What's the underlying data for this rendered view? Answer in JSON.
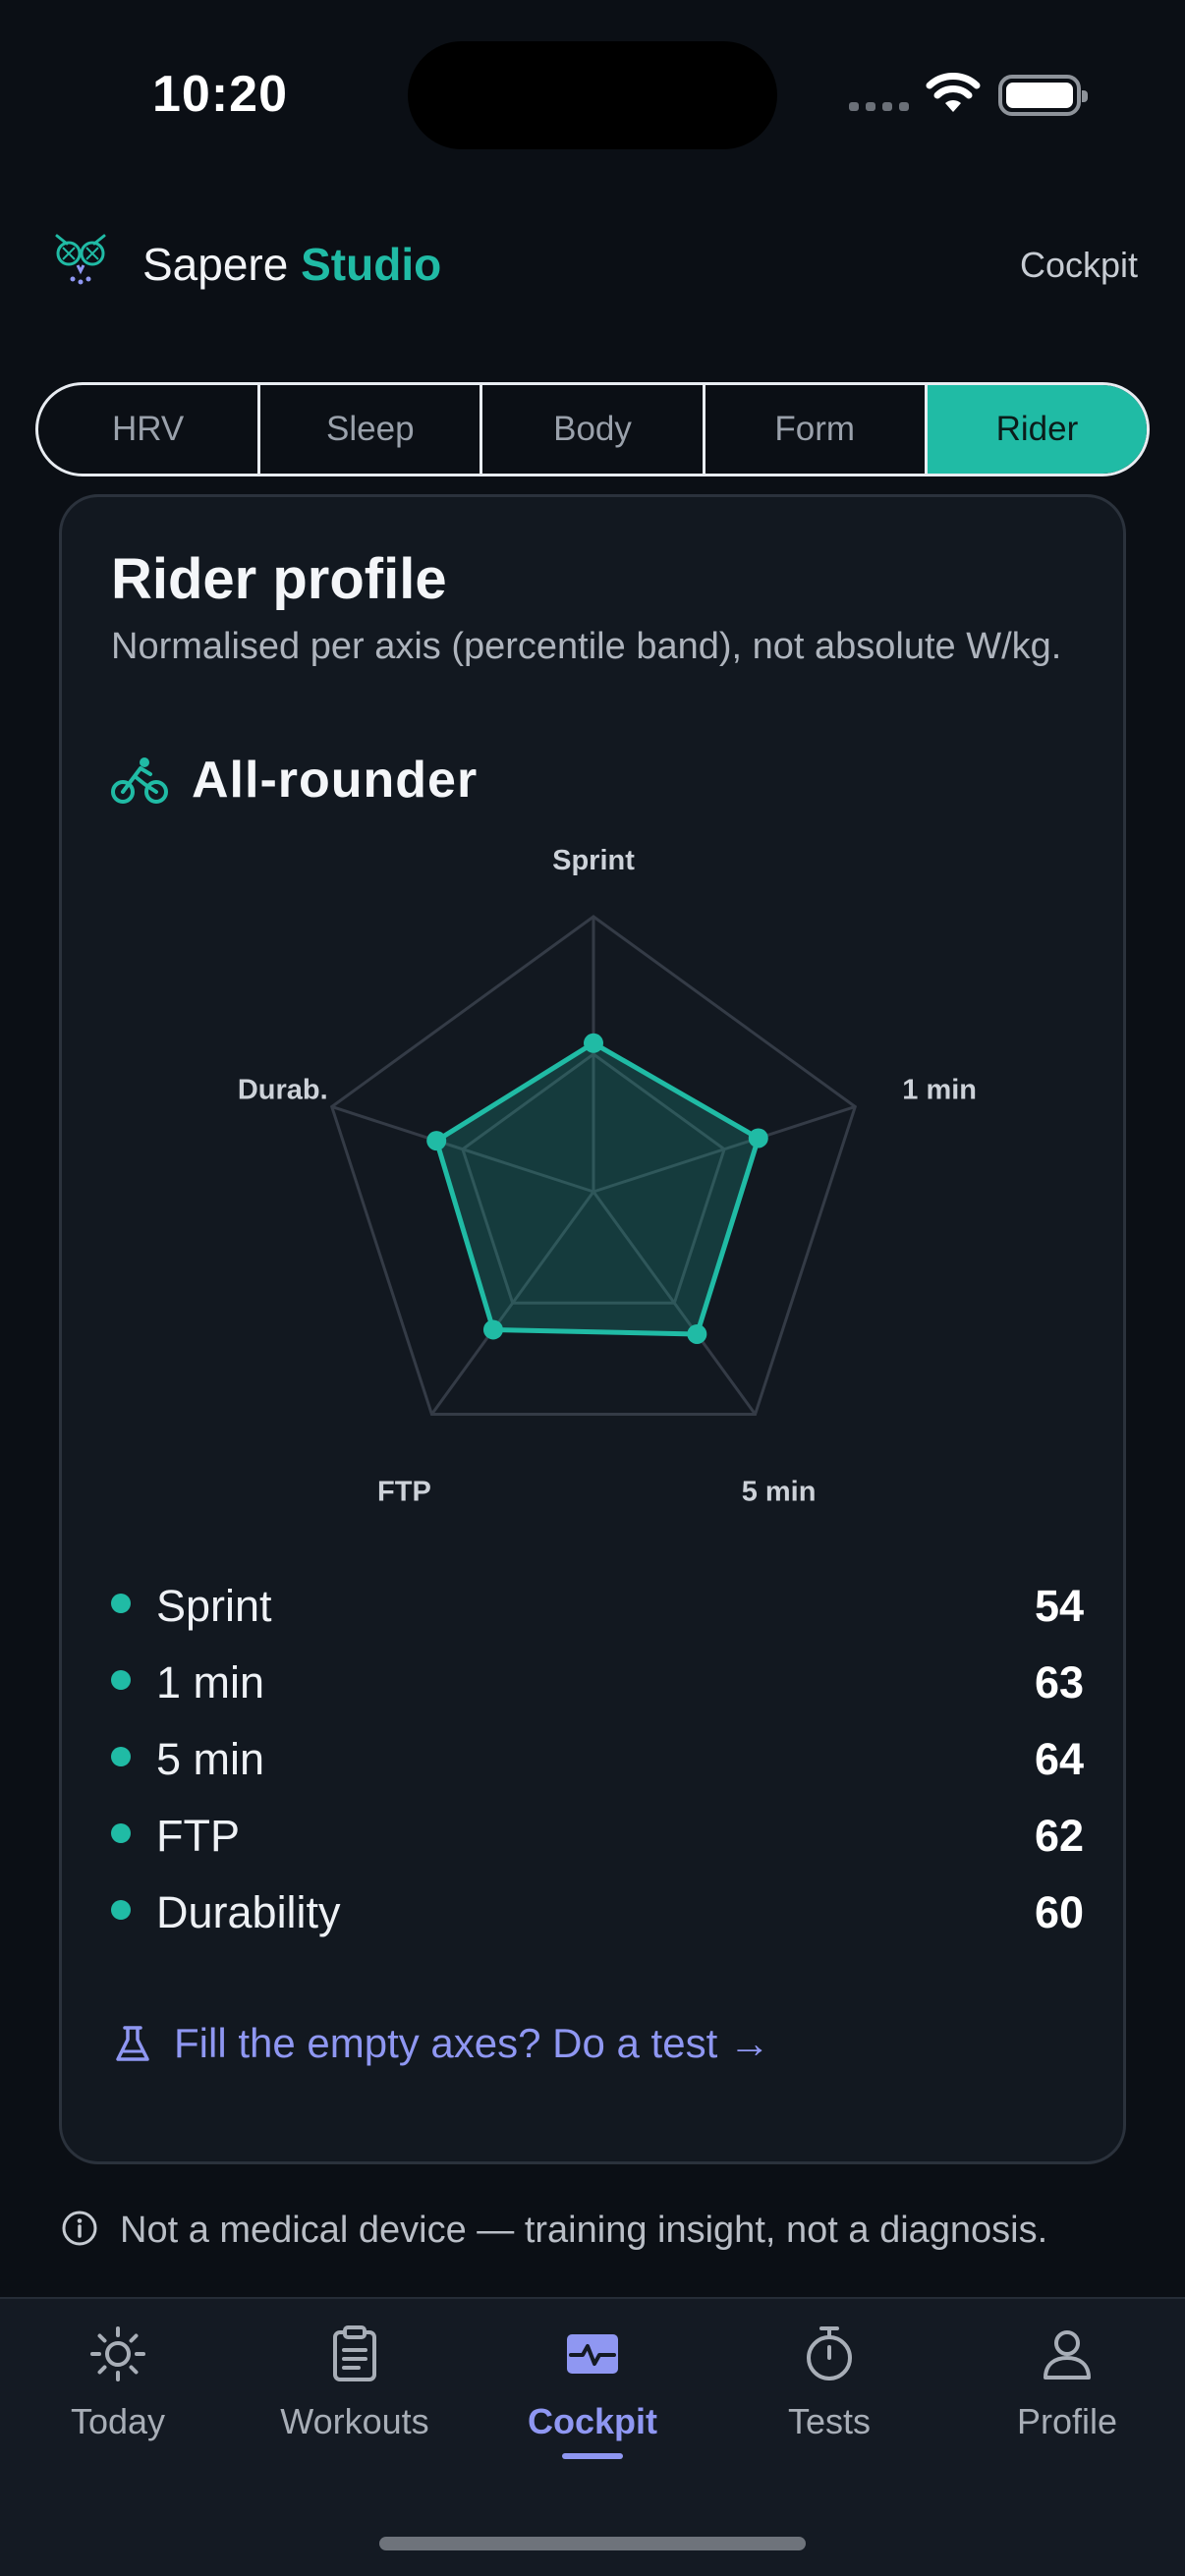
{
  "status_bar": {
    "time": "10:20"
  },
  "header": {
    "brand_name": "Sapere",
    "brand_accent": "Studio",
    "section_link": "Cockpit"
  },
  "tabs": [
    {
      "label": "HRV",
      "active": false
    },
    {
      "label": "Sleep",
      "active": false
    },
    {
      "label": "Body",
      "active": false
    },
    {
      "label": "Form",
      "active": false
    },
    {
      "label": "Rider",
      "active": true
    }
  ],
  "card": {
    "title": "Rider profile",
    "subtitle": "Normalised per axis (percentile band), not absolute W/kg.",
    "rider_type": "All-rounder",
    "rider_type_icon": "bike-icon",
    "radar_axes": [
      "Sprint",
      "1 min",
      "5 min",
      "FTP",
      "Durab."
    ],
    "metrics": [
      {
        "name": "Sprint",
        "value": "54"
      },
      {
        "name": "1 min",
        "value": "63"
      },
      {
        "name": "5 min",
        "value": "64"
      },
      {
        "name": "FTP",
        "value": "62"
      },
      {
        "name": "Durability",
        "value": "60"
      }
    ],
    "cta_label": "Fill the empty axes? Do a test →",
    "cta_icon": "flask-icon"
  },
  "chart_data": {
    "type": "radar",
    "categories": [
      "Sprint",
      "1 min",
      "5 min",
      "FTP",
      "Durab."
    ],
    "values": [
      54,
      63,
      64,
      62,
      60
    ],
    "ylim": [
      0,
      100
    ]
  },
  "disclaimer": "Not a medical device — training insight, not a diagnosis.",
  "nav": [
    {
      "label": "Today",
      "icon": "sun-icon",
      "active": false
    },
    {
      "label": "Workouts",
      "icon": "clipboard-icon",
      "active": false
    },
    {
      "label": "Cockpit",
      "icon": "activity-icon",
      "active": true
    },
    {
      "label": "Tests",
      "icon": "stopwatch-icon",
      "active": false
    },
    {
      "label": "Profile",
      "icon": "person-icon",
      "active": false
    }
  ],
  "colors": {
    "accent": "#20bba5",
    "link": "#8f97f2",
    "background": "#0b0f15",
    "card": "#121820"
  }
}
